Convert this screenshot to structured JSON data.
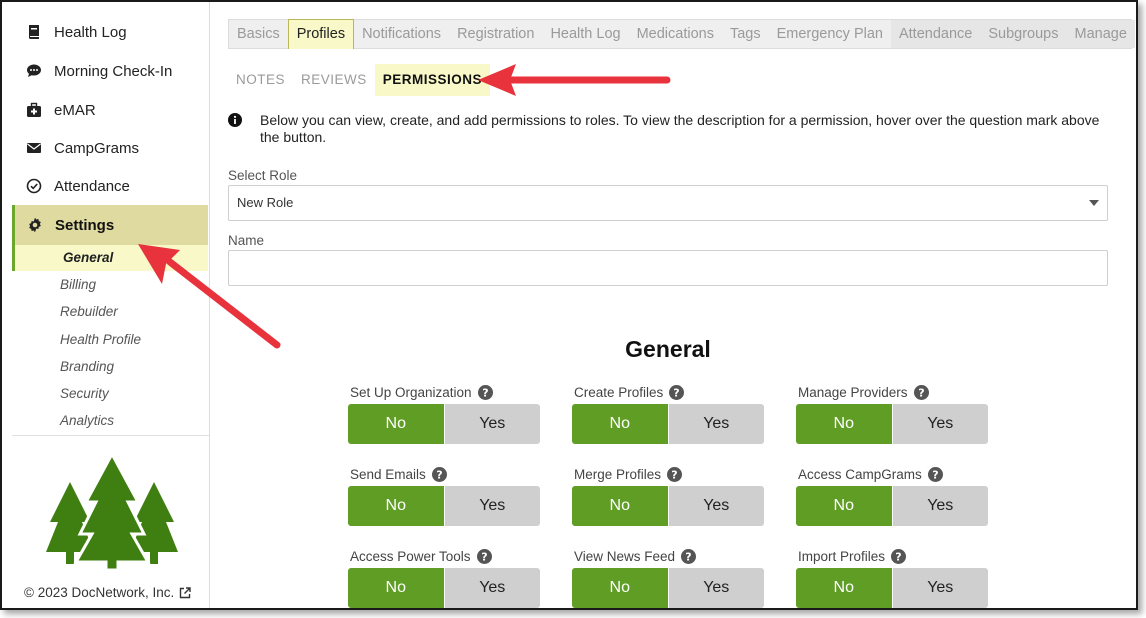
{
  "sidebar": {
    "items": [
      {
        "label": "Health Log",
        "icon": "book-icon"
      },
      {
        "label": "Morning Check-In",
        "icon": "chat-icon"
      },
      {
        "label": "eMAR",
        "icon": "medkit-icon"
      },
      {
        "label": "CampGrams",
        "icon": "envelope-icon"
      },
      {
        "label": "Attendance",
        "icon": "check-circle-icon"
      }
    ],
    "settings_label": "Settings",
    "sub_items": [
      "General",
      "Billing",
      "Rebuilder",
      "Health Profile",
      "Branding",
      "Security",
      "Analytics"
    ],
    "active_sub": "General",
    "copyright": "© 2023 DocNetwork, Inc."
  },
  "tabs": [
    "Basics",
    "Profiles",
    "Notifications",
    "Registration",
    "Health Log",
    "Medications",
    "Tags",
    "Emergency Plan",
    "Attendance",
    "Subgroups",
    "Manage"
  ],
  "active_tab": "Profiles",
  "subtabs": [
    "NOTES",
    "REVIEWS",
    "PERMISSIONS"
  ],
  "active_subtab": "PERMISSIONS",
  "info_text": "Below you can view, create, and add permissions to roles. To view the description for a permission, hover over the question mark above the button.",
  "role": {
    "label": "Select Role",
    "value": "New Role"
  },
  "name": {
    "label": "Name",
    "value": ""
  },
  "section_title": "General",
  "toggle": {
    "no": "No",
    "yes": "Yes"
  },
  "permissions": [
    "Set Up Organization",
    "Create Profiles",
    "Manage Providers",
    "Send Emails",
    "Merge Profiles",
    "Access CampGrams",
    "Access Power Tools",
    "View News Feed",
    "Import Profiles"
  ],
  "colors": {
    "accent_green": "#5f9d25",
    "highlight": "#f8f8c8",
    "arrow_red": "#e8323c",
    "tree_green": "#3f7f12"
  }
}
